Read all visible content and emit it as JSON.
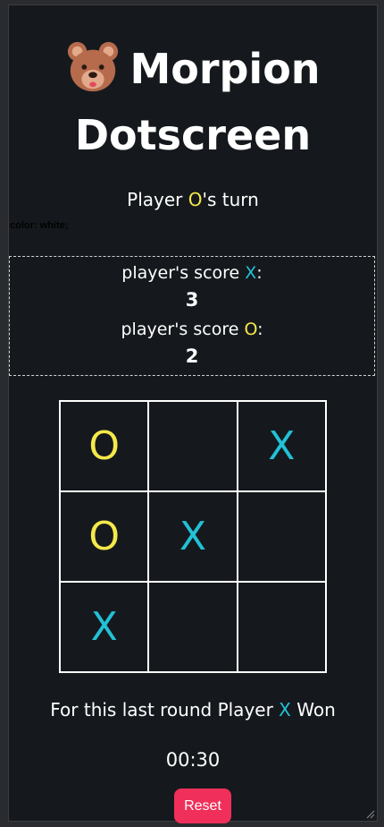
{
  "title": {
    "line1": "Morpion",
    "line2": "Dotscreen",
    "icon": "bear-face-icon"
  },
  "turn": {
    "prefix": "Player ",
    "symbol": "O",
    "suffix": "'s turn"
  },
  "stray_text": "color: white;",
  "scores": {
    "x_label_prefix": "player's score ",
    "x_symbol": "X",
    "x_label_suffix": ":",
    "x_value": "3",
    "o_label_prefix": "player's score ",
    "o_symbol": "O",
    "o_label_suffix": ":",
    "o_value": "2"
  },
  "board": [
    [
      "O",
      "",
      "X"
    ],
    [
      "O",
      "X",
      ""
    ],
    [
      "X",
      "",
      ""
    ]
  ],
  "result": {
    "prefix": "For this last round Player ",
    "symbol": "X",
    "suffix": " Won"
  },
  "timer": "00:30",
  "reset_label": "Reset",
  "colors": {
    "background": "#15191d",
    "o_color": "#f5e84a",
    "x_color": "#22c1d6",
    "reset_bg": "#f0305a"
  }
}
